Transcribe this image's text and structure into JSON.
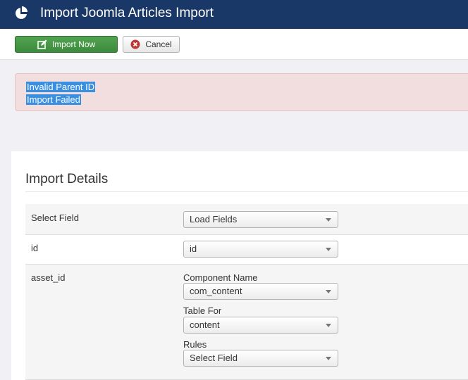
{
  "header": {
    "title": "Import Joomla Articles Import",
    "logo_icon": "joomla-pie-icon"
  },
  "toolbar": {
    "import_label": "Import Now",
    "import_icon": "edit-icon",
    "cancel_label": "Cancel",
    "cancel_icon": "cancel-circle-icon"
  },
  "alert": {
    "lines": [
      "Invalid Parent ID",
      "Import Failed"
    ]
  },
  "details": {
    "heading": "Import Details",
    "rows": [
      {
        "label": "Select Field",
        "select_value": "Load Fields"
      },
      {
        "label": "id",
        "select_value": "id"
      },
      {
        "label": "asset_id",
        "fields": [
          {
            "label": "Component Name",
            "value": "com_content"
          },
          {
            "label": "Table For",
            "value": "content"
          },
          {
            "label": "Rules",
            "value": "Select Field"
          }
        ]
      }
    ]
  },
  "colors": {
    "header_bg": "#1a3867",
    "import_button": "#46a046",
    "alert_bg": "#f2dede",
    "selection": "#3b8fe0"
  }
}
